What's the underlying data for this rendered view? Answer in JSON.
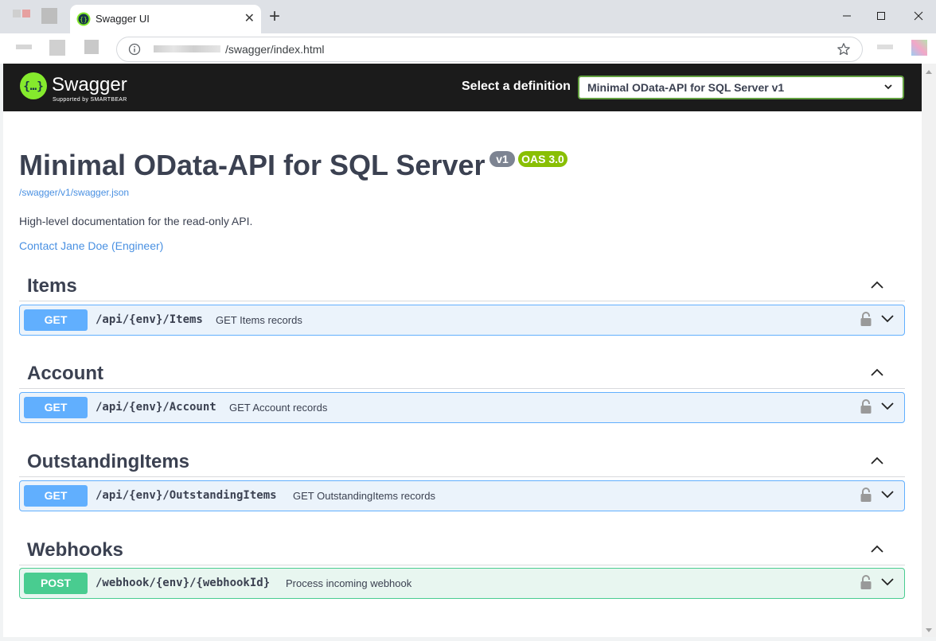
{
  "browser": {
    "tab_title": "Swagger UI",
    "url_path": "/swagger/index.html"
  },
  "topbar": {
    "logo_text": "Swagger",
    "logo_subtext": "Supported by SMARTBEAR",
    "select_label": "Select a definition",
    "selected_definition": "Minimal OData-API for SQL Server v1"
  },
  "info": {
    "title": "Minimal OData-API for SQL Server",
    "version_badge": "v1",
    "oas_badge": "OAS 3.0",
    "spec_url": "/swagger/v1/swagger.json",
    "description": "High-level documentation for the read-only API.",
    "contact": "Contact Jane Doe (Engineer)"
  },
  "tags": [
    {
      "name": "Items",
      "operation": {
        "method": "GET",
        "path": "/api/{env}/Items",
        "summary": "GET Items records"
      }
    },
    {
      "name": "Account",
      "operation": {
        "method": "GET",
        "path": "/api/{env}/Account",
        "summary": "GET Account records"
      }
    },
    {
      "name": "OutstandingItems",
      "operation": {
        "method": "GET",
        "path": "/api/{env}/OutstandingItems",
        "summary": "GET OutstandingItems records"
      }
    },
    {
      "name": "Webhooks",
      "operation": {
        "method": "POST",
        "path": "/webhook/{env}/{webhookId}",
        "summary": "Process incoming webhook"
      }
    }
  ],
  "colors": {
    "get": "#61affe",
    "post": "#49cc90",
    "swagger_green": "#85ea2d",
    "topbar": "#1b1b1b"
  }
}
